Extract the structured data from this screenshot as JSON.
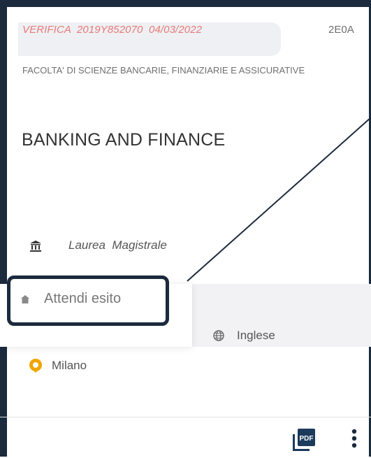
{
  "card": {
    "verifica_label": "VERIFICA  2019Y852070  04/03/2022",
    "course_code": "2E0A",
    "faculty": "FACOLTA' DI SCIENZE BANCARIE, FINANZIARIE E ASSICURATIVE",
    "course_title": "BANKING AND FINANCE",
    "degree_type": "Laurea  Magistrale",
    "status": "Attendi esito",
    "language": "Inglese",
    "city": "Milano",
    "pdf_label": "PDF"
  },
  "icons": {
    "degree": "university-building-icon",
    "status": "home-icon",
    "language": "globe-icon",
    "city": "location-pin-icon",
    "pdf": "pdf-document-icon",
    "more": "more-vertical-icon"
  },
  "colors": {
    "frame": "#1b2a3d",
    "verifica_text": "#e87878",
    "pin": "#f0a500",
    "pdf_icon": "#1b3a5c"
  }
}
